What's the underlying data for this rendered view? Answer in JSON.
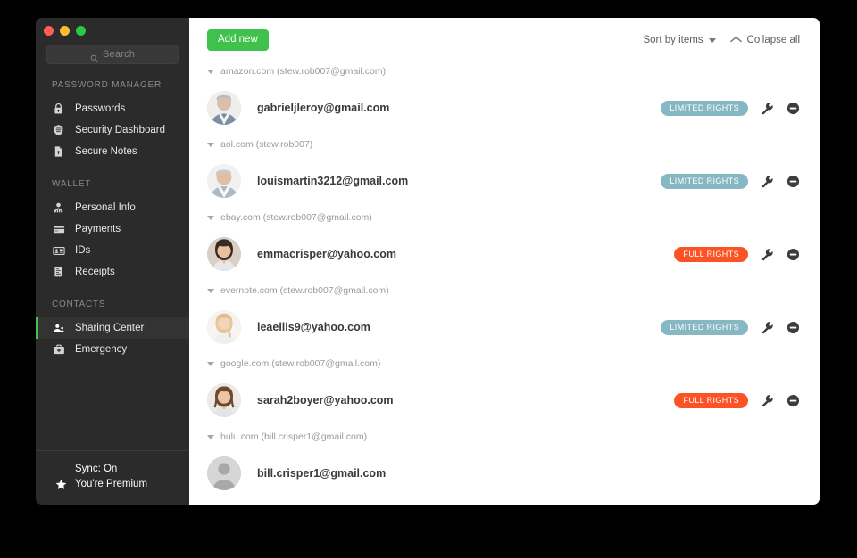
{
  "window": {
    "traffic_lights": [
      "close",
      "minimize",
      "zoom"
    ],
    "accent_green": "#3fc14c"
  },
  "sidebar": {
    "search": {
      "placeholder": "Search",
      "value": "",
      "icon": "search-icon"
    },
    "sections": [
      {
        "title": "PASSWORD MANAGER",
        "items": [
          {
            "label": "Passwords",
            "icon": "lock-icon",
            "active": false
          },
          {
            "label": "Security Dashboard",
            "icon": "shield-icon",
            "active": false
          },
          {
            "label": "Secure Notes",
            "icon": "note-icon",
            "active": false
          }
        ]
      },
      {
        "title": "WALLET",
        "items": [
          {
            "label": "Personal Info",
            "icon": "person-icon",
            "active": false
          },
          {
            "label": "Payments",
            "icon": "credit-card-icon",
            "active": false
          },
          {
            "label": "IDs",
            "icon": "id-card-icon",
            "active": false
          },
          {
            "label": "Receipts",
            "icon": "receipt-icon",
            "active": false
          }
        ]
      },
      {
        "title": "CONTACTS",
        "items": [
          {
            "label": "Sharing Center",
            "icon": "people-icon",
            "active": true
          },
          {
            "label": "Emergency",
            "icon": "first-aid-kit-icon",
            "active": false
          }
        ]
      }
    ],
    "footer": {
      "sync_status": "Sync: On",
      "premium_label": "You're Premium",
      "premium_icon": "star-icon"
    }
  },
  "toolbar": {
    "add_new_label": "Add new",
    "sort_label": "Sort by items",
    "collapse_label": "Collapse all",
    "sort_icon": "chevron-down-icon",
    "collapse_icon": "chevron-up-icon"
  },
  "groups": [
    {
      "header": "amazon.com (stew.rob007@gmail.com)",
      "rows": [
        {
          "email": "gabrieljleroy@gmail.com",
          "avatar": "man-grey-hair-avatar",
          "badge": "LIMITED RIGHTS",
          "badge_type": "limited",
          "actions": [
            "wrench-icon",
            "remove-icon"
          ]
        }
      ]
    },
    {
      "header": "aol.com (stew.rob007)",
      "rows": [
        {
          "email": "louismartin3212@gmail.com",
          "avatar": "man-smiling-avatar",
          "badge": "LIMITED RIGHTS",
          "badge_type": "limited",
          "actions": [
            "wrench-icon",
            "remove-icon"
          ]
        }
      ]
    },
    {
      "header": "ebay.com (stew.rob007@gmail.com)",
      "rows": [
        {
          "email": "emmacrisper@yahoo.com",
          "avatar": "woman-dark-hair-avatar",
          "badge": "FULL RIGHTS",
          "badge_type": "full",
          "actions": [
            "wrench-icon",
            "remove-icon"
          ]
        }
      ]
    },
    {
      "header": "evernote.com (stew.rob007@gmail.com)",
      "rows": [
        {
          "email": "leaellis9@yahoo.com",
          "avatar": "woman-blonde-avatar",
          "badge": "LIMITED RIGHTS",
          "badge_type": "limited",
          "actions": [
            "wrench-icon",
            "remove-icon"
          ]
        }
      ]
    },
    {
      "header": "google.com (stew.rob007@gmail.com)",
      "rows": [
        {
          "email": "sarah2boyer@yahoo.com",
          "avatar": "woman-brunette-avatar",
          "badge": "FULL RIGHTS",
          "badge_type": "full",
          "actions": [
            "wrench-icon",
            "remove-icon"
          ]
        }
      ]
    },
    {
      "header": "hulu.com (bill.crisper1@gmail.com)",
      "rows": [
        {
          "email": "bill.crisper1@gmail.com",
          "avatar": "placeholder-avatar",
          "badge": "",
          "badge_type": "none",
          "actions": []
        }
      ]
    }
  ]
}
